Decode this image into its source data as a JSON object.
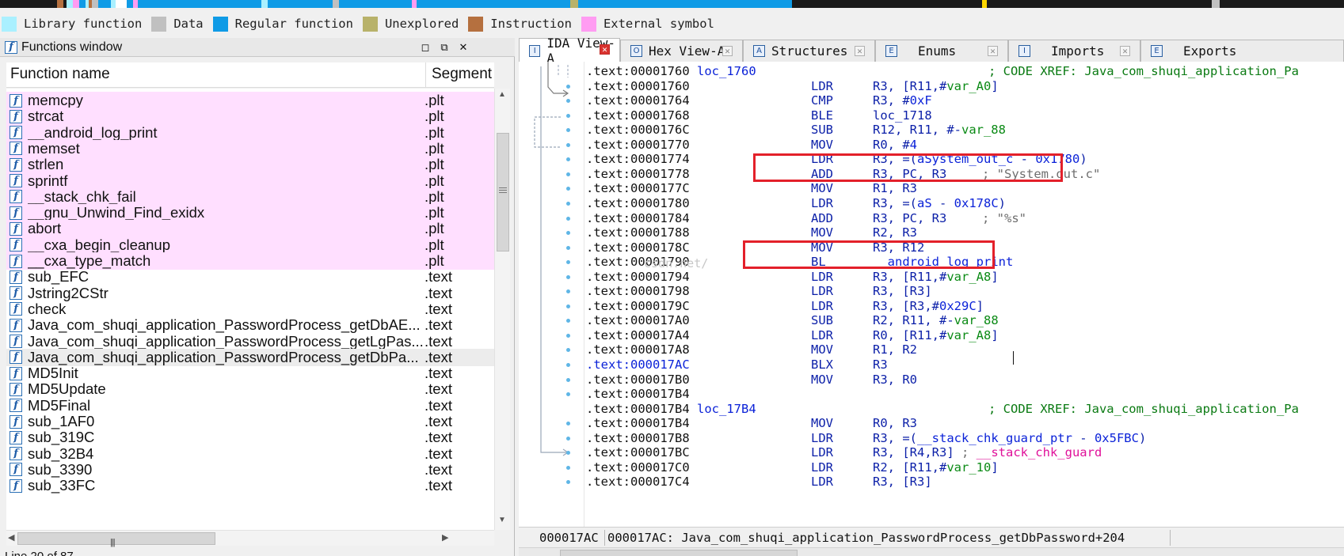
{
  "legend": [
    {
      "label": "Library function",
      "color": "#aaf0ff"
    },
    {
      "label": "Data",
      "color": "#c0c0c0"
    },
    {
      "label": "Regular function",
      "color": "#0f9be6"
    },
    {
      "label": "Unexplored",
      "color": "#b8b26a"
    },
    {
      "label": "Instruction",
      "color": "#b5703f"
    },
    {
      "label": "External symbol",
      "color": "#ff9cf2"
    }
  ],
  "functions_window": {
    "title": "Functions window",
    "col_name": "Function name",
    "col_segment": "Segment",
    "status": "Line 20 of 87",
    "rows": [
      {
        "name": "memcpy",
        "segment": ".plt",
        "kind": "external"
      },
      {
        "name": "strcat",
        "segment": ".plt",
        "kind": "external"
      },
      {
        "name": "__android_log_print",
        "segment": ".plt",
        "kind": "external"
      },
      {
        "name": "memset",
        "segment": ".plt",
        "kind": "external"
      },
      {
        "name": "strlen",
        "segment": ".plt",
        "kind": "external"
      },
      {
        "name": "sprintf",
        "segment": ".plt",
        "kind": "external"
      },
      {
        "name": "__stack_chk_fail",
        "segment": ".plt",
        "kind": "external"
      },
      {
        "name": "__gnu_Unwind_Find_exidx",
        "segment": ".plt",
        "kind": "external"
      },
      {
        "name": "abort",
        "segment": ".plt",
        "kind": "external"
      },
      {
        "name": "__cxa_begin_cleanup",
        "segment": ".plt",
        "kind": "external"
      },
      {
        "name": "__cxa_type_match",
        "segment": ".plt",
        "kind": "external"
      },
      {
        "name": "sub_EFC",
        "segment": ".text",
        "kind": "regular"
      },
      {
        "name": "Jstring2CStr",
        "segment": ".text",
        "kind": "regular"
      },
      {
        "name": "check",
        "segment": ".text",
        "kind": "regular"
      },
      {
        "name": "Java_com_shuqi_application_PasswordProcess_getDbAE...",
        "segment": ".text",
        "kind": "regular"
      },
      {
        "name": "Java_com_shuqi_application_PasswordProcess_getLgPas...",
        "segment": ".text",
        "kind": "regular"
      },
      {
        "name": "Java_com_shuqi_application_PasswordProcess_getDbPa...",
        "segment": ".text",
        "kind": "selected"
      },
      {
        "name": "MD5Init",
        "segment": ".text",
        "kind": "regular"
      },
      {
        "name": "MD5Update",
        "segment": ".text",
        "kind": "regular"
      },
      {
        "name": "MD5Final",
        "segment": ".text",
        "kind": "regular"
      },
      {
        "name": "sub_1AF0",
        "segment": ".text",
        "kind": "regular"
      },
      {
        "name": "sub_319C",
        "segment": ".text",
        "kind": "regular"
      },
      {
        "name": "sub_32B4",
        "segment": ".text",
        "kind": "regular"
      },
      {
        "name": "sub_3390",
        "segment": ".text",
        "kind": "regular"
      },
      {
        "name": "sub_33FC",
        "segment": ".text",
        "kind": "regular"
      }
    ]
  },
  "tabs": [
    {
      "label": "IDA View-A",
      "icon": "ida-view-icon",
      "active": true
    },
    {
      "label": "Hex View-A",
      "icon": "hex-view-icon",
      "active": false
    },
    {
      "label": "Structures",
      "icon": "structures-icon",
      "active": false
    },
    {
      "label": "Enums",
      "icon": "enums-icon",
      "active": false
    },
    {
      "label": "Imports",
      "icon": "imports-icon",
      "active": false
    },
    {
      "label": "Exports",
      "icon": "exports-icon",
      "active": false
    }
  ],
  "disasm": [
    {
      "addr": ".text:00001760",
      "label": "loc_1760",
      "xref": "; CODE XREF: Java_com_shuqi_application_Pa"
    },
    {
      "addr": ".text:00001760",
      "mn": "LDR",
      "ops": [
        [
          "R3, [R11,#",
          ""
        ],
        [
          "var_A0",
          "var"
        ],
        [
          "]",
          ""
        ]
      ]
    },
    {
      "addr": ".text:00001764",
      "mn": "CMP",
      "ops": [
        [
          "R3, #",
          ""
        ],
        [
          "0xF",
          "num"
        ]
      ]
    },
    {
      "addr": ".text:00001768",
      "mn": "BLE",
      "ops": [
        [
          "loc_1718",
          ""
        ]
      ]
    },
    {
      "addr": ".text:0000176C",
      "mn": "SUB",
      "ops": [
        [
          "R12, R11, #-",
          ""
        ],
        [
          "var_88",
          "var"
        ]
      ]
    },
    {
      "addr": ".text:00001770",
      "mn": "MOV",
      "ops": [
        [
          "R0, #",
          ""
        ],
        [
          "4",
          "num"
        ]
      ]
    },
    {
      "addr": ".text:00001774",
      "mn": "LDR",
      "ops": [
        [
          "R3, =(",
          ""
        ],
        [
          "aSystem_out_c",
          "sym"
        ],
        [
          " - ",
          ""
        ],
        [
          "0x1780",
          "num"
        ],
        [
          ")",
          ""
        ]
      ]
    },
    {
      "addr": ".text:00001778",
      "mn": "ADD",
      "ops": [
        [
          "R3, PC, R3",
          ""
        ]
      ],
      "comment": "; \"System.out.c\""
    },
    {
      "addr": ".text:0000177C",
      "mn": "MOV",
      "ops": [
        [
          "R1, R3",
          ""
        ]
      ]
    },
    {
      "addr": ".text:00001780",
      "mn": "LDR",
      "ops": [
        [
          "R3, =(",
          ""
        ],
        [
          "aS",
          "sym"
        ],
        [
          " - ",
          ""
        ],
        [
          "0x178C",
          "num"
        ],
        [
          ")",
          ""
        ]
      ]
    },
    {
      "addr": ".text:00001784",
      "mn": "ADD",
      "ops": [
        [
          "R3, PC, R3",
          ""
        ]
      ],
      "comment": "; \"%s\""
    },
    {
      "addr": ".text:00001788",
      "mn": "MOV",
      "ops": [
        [
          "R2, R3",
          ""
        ]
      ]
    },
    {
      "addr": ".text:0000178C",
      "mn": "MOV",
      "ops": [
        [
          "R3, R12",
          ""
        ]
      ]
    },
    {
      "addr": ".text:00001790",
      "mn": "BL",
      "ops": [
        [
          "__android_log_print",
          "sym"
        ]
      ]
    },
    {
      "addr": ".text:00001794",
      "mn": "LDR",
      "ops": [
        [
          "R3, [R11,#",
          ""
        ],
        [
          "var_A8",
          "var"
        ],
        [
          "]",
          ""
        ]
      ]
    },
    {
      "addr": ".text:00001798",
      "mn": "LDR",
      "ops": [
        [
          "R3, [R3]",
          ""
        ]
      ]
    },
    {
      "addr": ".text:0000179C",
      "mn": "LDR",
      "ops": [
        [
          "R3, [R3,#",
          ""
        ],
        [
          "0x29C",
          "num"
        ],
        [
          "]",
          ""
        ]
      ]
    },
    {
      "addr": ".text:000017A0",
      "mn": "SUB",
      "ops": [
        [
          "R2, R11, #-",
          ""
        ],
        [
          "var_88",
          "var"
        ]
      ]
    },
    {
      "addr": ".text:000017A4",
      "mn": "LDR",
      "ops": [
        [
          "R0, [R11,#",
          ""
        ],
        [
          "var_A8",
          "var"
        ],
        [
          "]",
          ""
        ]
      ]
    },
    {
      "addr": ".text:000017A8",
      "mn": "MOV",
      "ops": [
        [
          "R1, R2",
          ""
        ]
      ]
    },
    {
      "addr": ".text:000017AC",
      "mn": "BLX",
      "ops": [
        [
          "R3",
          ""
        ]
      ],
      "current": true
    },
    {
      "addr": ".text:000017B0",
      "mn": "MOV",
      "ops": [
        [
          "R3, R0",
          ""
        ]
      ]
    },
    {
      "addr": ".text:000017B4"
    },
    {
      "addr": ".text:000017B4",
      "label": "loc_17B4",
      "xref": "; CODE XREF: Java_com_shuqi_application_Pa"
    },
    {
      "addr": ".text:000017B4",
      "mn": "MOV",
      "ops": [
        [
          "R0, R3",
          ""
        ]
      ]
    },
    {
      "addr": ".text:000017B8",
      "mn": "LDR",
      "ops": [
        [
          "R3, =(",
          ""
        ],
        [
          "__stack_chk_guard_ptr",
          "sym"
        ],
        [
          " - ",
          ""
        ],
        [
          "0x5FBC",
          "num"
        ],
        [
          ")",
          ""
        ]
      ]
    },
    {
      "addr": ".text:000017BC",
      "mn": "LDR",
      "ops": [
        [
          "R3, [R4,R3]",
          ""
        ],
        [
          " ; ",
          "sep"
        ],
        [
          "__stack_chk_guard",
          "ext"
        ]
      ]
    },
    {
      "addr": ".text:000017C0",
      "mn": "LDR",
      "ops": [
        [
          "R2, [R11,#",
          ""
        ],
        [
          "var_10",
          "var"
        ],
        [
          "]",
          ""
        ]
      ]
    },
    {
      "addr": ".text:000017C4",
      "mn": "LDR",
      "ops": [
        [
          "R3, [R3]",
          ""
        ]
      ]
    }
  ],
  "watermark": "csdn.net/",
  "status": {
    "offset": "000017AC",
    "location": "000017AC: Java_com_shuqi_application_PasswordProcess_getDbPassword+204"
  },
  "colors": {
    "highlight_box": "#e3202a",
    "external_row": "#ffdfff",
    "selected_row": "#ececec"
  }
}
